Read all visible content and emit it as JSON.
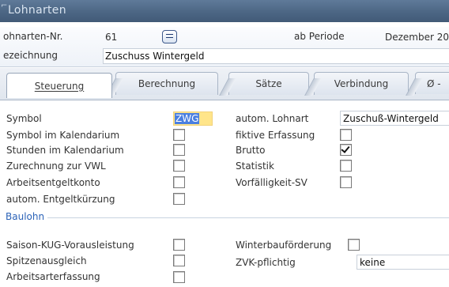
{
  "window": {
    "title": "Lohnarten"
  },
  "header": {
    "nr_label": "ohnarten-Nr.",
    "nr_value": "61",
    "period_label": "ab Periode",
    "period_value": "Dezember 20",
    "bez_label": "ezeichnung",
    "bez_value": "Zuschuss Wintergeld"
  },
  "tabs": [
    {
      "label": "Steuerung",
      "active": true
    },
    {
      "label": "Berechnung",
      "active": false
    },
    {
      "label": "Sätze",
      "active": false
    },
    {
      "label": "Verbindung",
      "active": false
    },
    {
      "label": "Ø -",
      "active": false
    }
  ],
  "steuerung": {
    "left": [
      {
        "label": "Symbol",
        "type": "text",
        "value": "ZWG"
      },
      {
        "label": "Symbol im Kalendarium",
        "type": "checkbox",
        "checked": false
      },
      {
        "label": "Stunden im Kalendarium",
        "type": "checkbox",
        "checked": false
      },
      {
        "label": "Zurechnung zur VWL",
        "type": "checkbox",
        "checked": false
      },
      {
        "label": "Arbeitsentgeltkonto",
        "type": "checkbox",
        "checked": false
      },
      {
        "label": "autom. Entgeltkürzung",
        "type": "checkbox",
        "checked": false
      }
    ],
    "right": [
      {
        "label": "autom. Lohnart",
        "type": "text",
        "value": "Zuschuß-Wintergeld"
      },
      {
        "label": "fiktive Erfassung",
        "type": "checkbox",
        "checked": false
      },
      {
        "label": "Brutto",
        "type": "checkbox",
        "checked": true
      },
      {
        "label": "Statistik",
        "type": "checkbox",
        "checked": false
      },
      {
        "label": "Vorfälligkeit-SV",
        "type": "checkbox",
        "checked": false
      }
    ]
  },
  "baulohn": {
    "title": "Baulohn",
    "left": [
      {
        "label": "Saison-KUG-Vorausleistung",
        "checked": false
      },
      {
        "label": "Spitzenausgleich",
        "checked": false
      },
      {
        "label": "Arbeitsarterfassung",
        "checked": false
      }
    ],
    "right": [
      {
        "label": "Winterbauförderung",
        "type": "checkbox",
        "checked": false
      },
      {
        "label": "ZVK-pflichtig",
        "type": "text",
        "value": "keine"
      }
    ]
  },
  "colors": {
    "titlebar": "#4c6684",
    "section": "#2c63b8",
    "symbol_highlight": "#ffe17a",
    "symbol_text": "#4a7fe0"
  }
}
